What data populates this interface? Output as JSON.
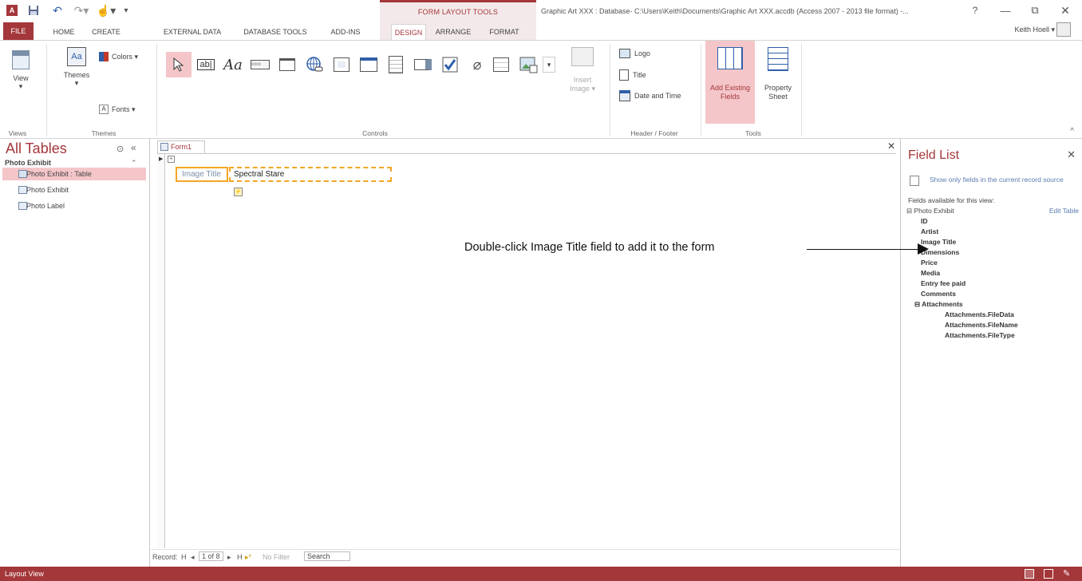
{
  "titlebar": {
    "context_group": "FORM LAYOUT TOOLS",
    "window_title": "Graphic Art XXX : Database- C:\\Users\\Keith\\Documents\\Graphic Art XXX.accdb (Access 2007 - 2013 file format) -...",
    "help": "?",
    "minimize": "—",
    "restore": "⧉",
    "close": "✕"
  },
  "tabs": [
    "FILE",
    "HOME",
    "CREATE",
    "EXTERNAL DATA",
    "DATABASE TOOLS",
    "ADD-INS",
    "DESIGN",
    "ARRANGE",
    "FORMAT"
  ],
  "active_tab": "DESIGN",
  "user": {
    "name": "Keith Hoell ▾"
  },
  "ribbon": {
    "view_label": "View",
    "themes_label": "Themes",
    "colors_label": "Colors ▾",
    "fonts_label": "Fonts ▾",
    "insert_image_label": "Insert Image ▾",
    "logo_label": "Logo",
    "title_label": "Title",
    "date_time_label": "Date and Time",
    "add_existing_label": "Add Existing Fields",
    "property_sheet_label": "Property Sheet",
    "groups": {
      "views": "Views",
      "themes": "Themes",
      "controls": "Controls",
      "header_footer": "Header / Footer",
      "tools": "Tools"
    }
  },
  "nav": {
    "title": "All Tables",
    "section": "Photo Exhibit",
    "items": [
      "Photo Exhibit : Table",
      "Photo Exhibit",
      "Photo Label"
    ]
  },
  "document": {
    "tab": "Form1",
    "label": "Image Title",
    "value": "Spectral Stare",
    "record_label": "Record: ",
    "record_first": "H",
    "record_prev": "◂",
    "record_current": "1 of 8",
    "record_next": "▸",
    "record_last": "H",
    "record_new": "▸*",
    "no_filter": "No Filter",
    "search": "Search"
  },
  "field_list": {
    "title": "Field List",
    "show_only": "Show only fields in the current record source",
    "available": "Fields available for this view:",
    "table": "⊟ Photo Exhibit",
    "edit_table": "Edit Table",
    "fields": [
      "ID",
      "Artist",
      "Image Title",
      "Dimensions",
      "Price",
      "Media",
      "Entry fee paid",
      "Comments",
      "⊟ Attachments"
    ],
    "sub_fields": [
      "Attachments.FileData",
      "Attachments.FileName",
      "Attachments.FileType"
    ]
  },
  "annotation": "Double-click Image Title field to add it to the form",
  "status": {
    "text": "Layout View"
  },
  "colors": {
    "accent": "#a4373a",
    "highlight": "#f4c6c9",
    "selection_border": "#f5a623"
  }
}
